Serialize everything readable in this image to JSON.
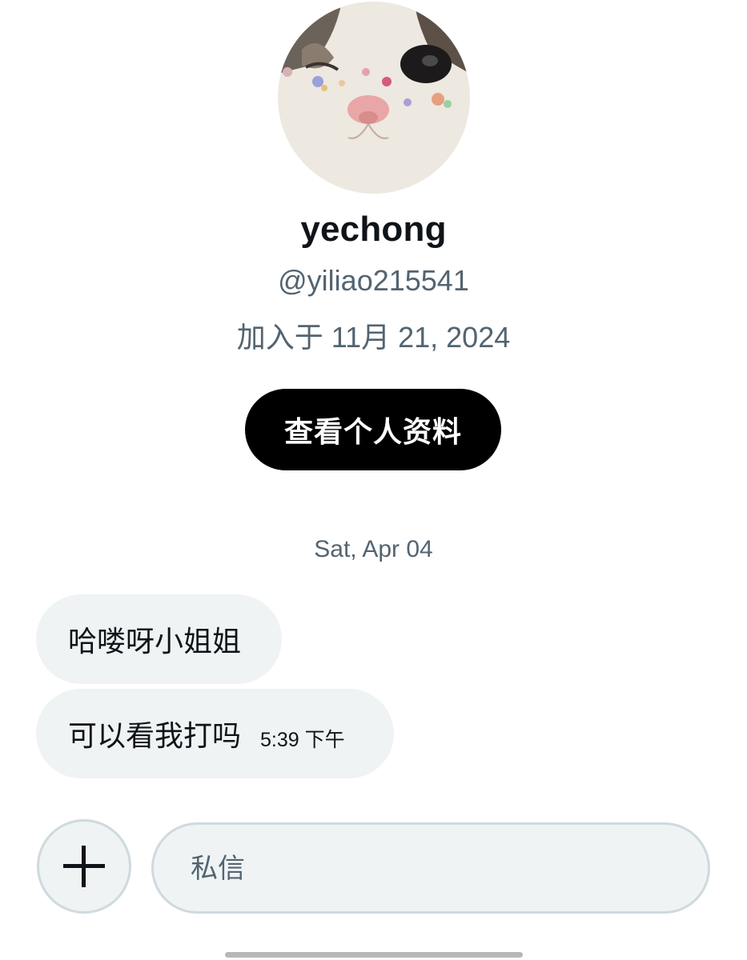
{
  "profile": {
    "display_name": "yechong",
    "handle": "@yiliao215541",
    "joined": "加入于 11月 21, 2024",
    "view_profile_label": "查看个人资料"
  },
  "conversation": {
    "date_separator": "Sat, Apr 04",
    "messages": [
      {
        "text": "哈喽呀小姐姐",
        "time": ""
      },
      {
        "text": "可以看我打吗",
        "time": "5:39 下午"
      }
    ]
  },
  "composer": {
    "placeholder": "私信",
    "value": "",
    "add_icon": "plus-icon"
  },
  "colors": {
    "primary_text": "#0f1419",
    "secondary_text": "#536471",
    "bubble_bg": "#eff3f4",
    "border": "#cfd9de",
    "button_bg": "#000000"
  }
}
